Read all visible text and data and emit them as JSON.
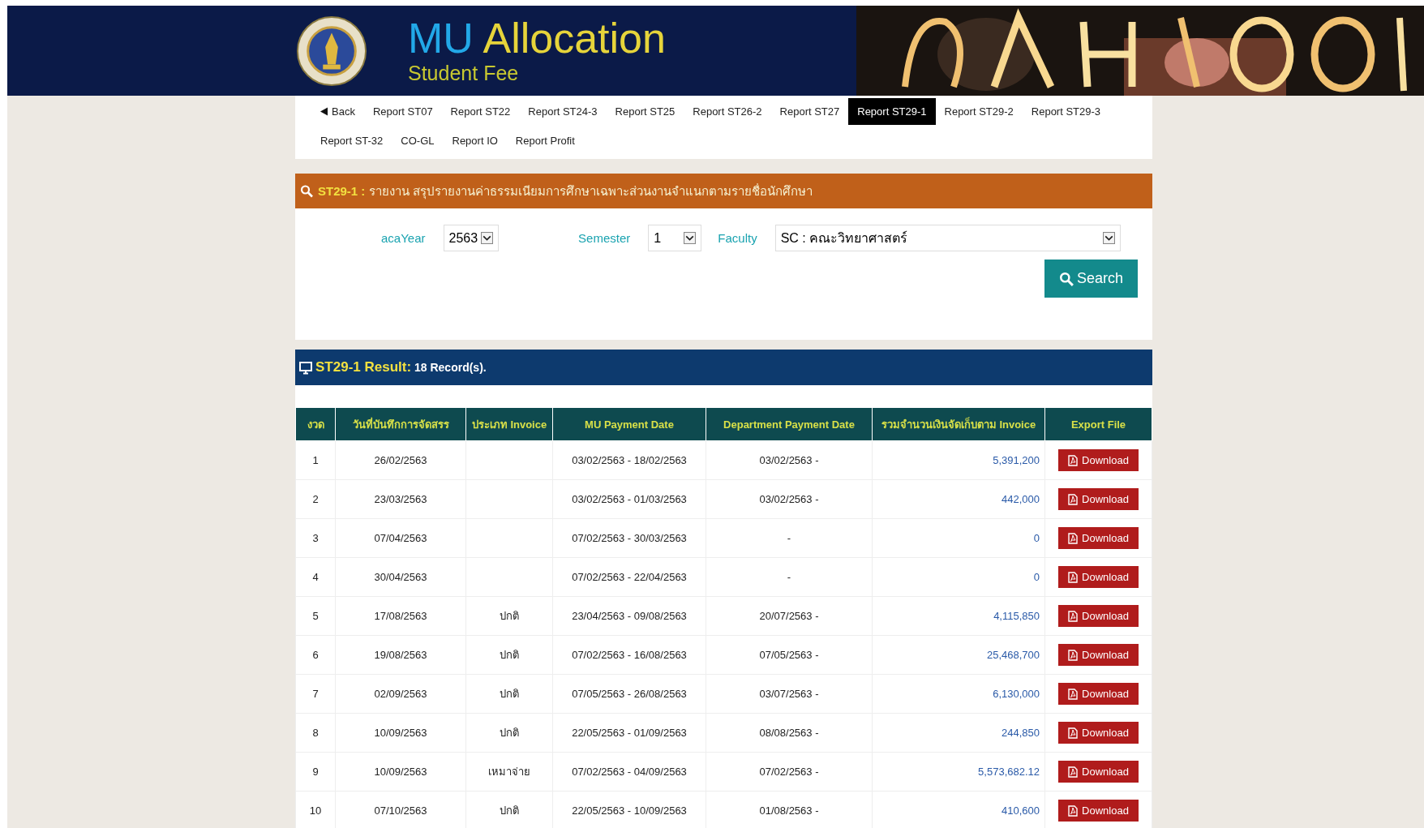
{
  "header": {
    "title_part1": "MU",
    "title_part2": "Allocation",
    "subtitle": "Student Fee"
  },
  "nav": {
    "back": "Back",
    "items": [
      {
        "label": "Report ST07",
        "selected": false
      },
      {
        "label": "Report ST22",
        "selected": false
      },
      {
        "label": "Report ST24-3",
        "selected": false
      },
      {
        "label": "Report ST25",
        "selected": false
      },
      {
        "label": "Report ST26-2",
        "selected": false
      },
      {
        "label": "Report ST27",
        "selected": false
      },
      {
        "label": "Report ST29-1",
        "selected": true
      },
      {
        "label": "Report ST29-2",
        "selected": false
      },
      {
        "label": "Report ST29-3",
        "selected": false
      },
      {
        "label": "Report ST-32",
        "selected": false
      },
      {
        "label": "CO-GL",
        "selected": false
      },
      {
        "label": "Report IO",
        "selected": false
      },
      {
        "label": "Report Profit",
        "selected": false
      }
    ]
  },
  "search_panel": {
    "code": "ST29-1 :",
    "title": "รายงาน สรุปรายงานค่าธรรมเนียมการศึกษาเฉพาะส่วนงานจำแนกตามรายชื่อนักศึกษา",
    "fields": [
      {
        "label": "acaYear",
        "value": "2563",
        "kind": "narrow"
      },
      {
        "label": "Semester",
        "value": "1",
        "kind": "narrow"
      },
      {
        "label": "Faculty",
        "value": "SC : คณะวิทยาศาสตร์",
        "kind": "wide"
      }
    ],
    "button": "Search"
  },
  "result": {
    "code": "ST29-1 Result:",
    "count": "18 Record(s).",
    "table": {
      "columns": [
        "งวด",
        "วันที่บันทึกการจัดสรร",
        "ประเภท Invoice",
        "MU Payment Date",
        "Department Payment Date",
        "รวมจำนวนเงินจัดเก็บตาม Invoice",
        "Export File"
      ],
      "rows": [
        {
          "no": "1",
          "date": "26/02/2563",
          "type": "",
          "mu_date": "03/02/2563 - 18/02/2563",
          "dept_date": "03/02/2563 -",
          "amount": "5,391,200",
          "export": "Download"
        },
        {
          "no": "2",
          "date": "23/03/2563",
          "type": "",
          "mu_date": "03/02/2563 - 01/03/2563",
          "dept_date": "03/02/2563 -",
          "amount": "442,000",
          "export": "Download"
        },
        {
          "no": "3",
          "date": "07/04/2563",
          "type": "",
          "mu_date": "07/02/2563 - 30/03/2563",
          "dept_date": "-",
          "amount": "0",
          "export": "Download"
        },
        {
          "no": "4",
          "date": "30/04/2563",
          "type": "",
          "mu_date": "07/02/2563 - 22/04/2563",
          "dept_date": "-",
          "amount": "0",
          "export": "Download"
        },
        {
          "no": "5",
          "date": "17/08/2563",
          "type": "ปกติ",
          "mu_date": "23/04/2563 - 09/08/2563",
          "dept_date": "20/07/2563 -",
          "amount": "4,115,850",
          "export": "Download"
        },
        {
          "no": "6",
          "date": "19/08/2563",
          "type": "ปกติ",
          "mu_date": "07/02/2563 - 16/08/2563",
          "dept_date": "07/05/2563 -",
          "amount": "25,468,700",
          "export": "Download"
        },
        {
          "no": "7",
          "date": "02/09/2563",
          "type": "ปกติ",
          "mu_date": "07/05/2563 - 26/08/2563",
          "dept_date": "03/07/2563 -",
          "amount": "6,130,000",
          "export": "Download"
        },
        {
          "no": "8",
          "date": "10/09/2563",
          "type": "ปกติ",
          "mu_date": "22/05/2563 - 01/09/2563",
          "dept_date": "08/08/2563 -",
          "amount": "244,850",
          "export": "Download"
        },
        {
          "no": "9",
          "date": "10/09/2563",
          "type": "เหมาจ่าย",
          "mu_date": "07/02/2563 - 04/09/2563",
          "dept_date": "07/02/2563 -",
          "amount": "5,573,682.12",
          "export": "Download"
        },
        {
          "no": "10",
          "date": "07/10/2563",
          "type": "ปกติ",
          "mu_date": "22/05/2563 - 10/09/2563",
          "dept_date": "01/08/2563 -",
          "amount": "410,600",
          "export": "Download"
        }
      ]
    }
  }
}
